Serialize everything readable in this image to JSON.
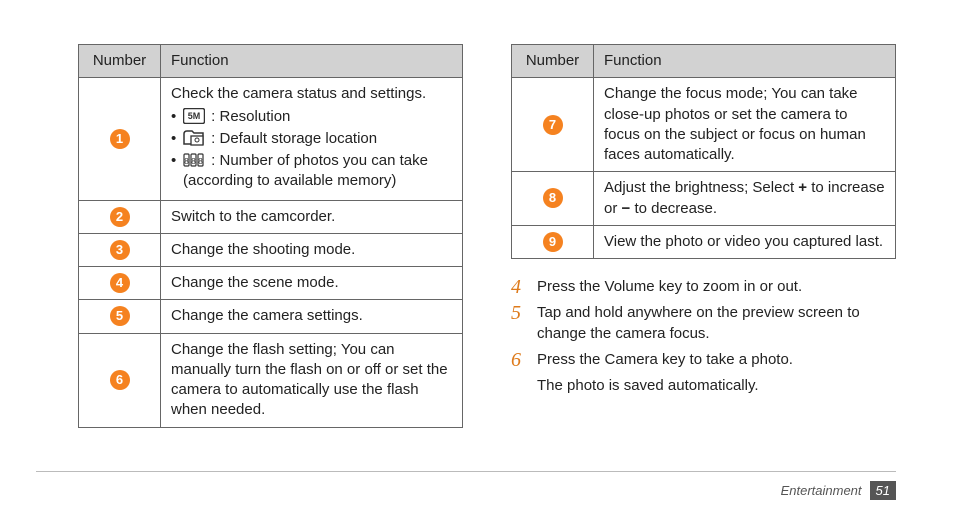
{
  "headers": {
    "number": "Number",
    "function": "Function"
  },
  "table1": {
    "row1": {
      "num": "1",
      "intro": "Check the camera status and settings.",
      "b1": " : Resolution",
      "b2": " : Default storage location",
      "b3": " : Number of photos you can take (according to available memory)"
    },
    "row2": {
      "num": "2",
      "text": "Switch to the camcorder."
    },
    "row3": {
      "num": "3",
      "text": "Change the shooting mode."
    },
    "row4": {
      "num": "4",
      "text": "Change the scene mode."
    },
    "row5": {
      "num": "5",
      "text": "Change the camera settings."
    },
    "row6": {
      "num": "6",
      "text": "Change the flash setting; You can manually turn the flash on or off or set the camera to automatically use the flash when needed."
    }
  },
  "table2": {
    "row7": {
      "num": "7",
      "text": "Change the focus mode; You can take close-up photos or set the camera to focus on the subject or focus on human faces automatically."
    },
    "row8": {
      "num": "8",
      "pre": "Adjust the brightness; Select ",
      "plus": "+",
      "mid": " to increase or ",
      "minus": "−",
      "post": " to decrease."
    },
    "row9": {
      "num": "9",
      "text": "View the photo or video you captured last."
    }
  },
  "steps": {
    "s4": {
      "num": "4",
      "text": "Press the Volume key to zoom in or out."
    },
    "s5": {
      "num": "5",
      "text": "Tap and hold anywhere on the preview screen to change the camera focus."
    },
    "s6": {
      "num": "6",
      "text": "Press the Camera key to take a photo.",
      "text2": "The photo is saved automatically."
    }
  },
  "footer": {
    "section": "Entertainment",
    "page": "51"
  }
}
